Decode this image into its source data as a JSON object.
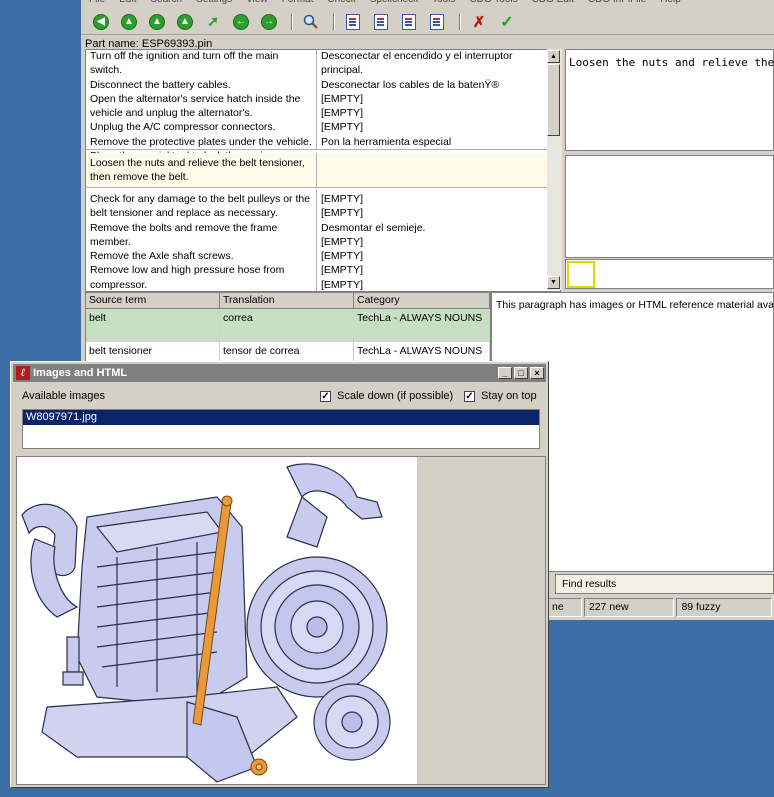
{
  "menu": [
    "File",
    "Edit",
    "Search",
    "Settings",
    "View",
    "Format",
    "Check",
    "Spellcheck",
    "Tools",
    "CDG Tools",
    "CDG Edit",
    "CDG InPlFile",
    "Help"
  ],
  "toolbar": {
    "icons": [
      "nav-first-icon",
      "nav-up-icon",
      "nav-up2-icon",
      "nav-up3-icon",
      "nav-arrow-icon",
      "nav-prev-icon",
      "nav-next-icon",
      "search-icon",
      "doc-icon-1",
      "doc-icon-2",
      "doc-icon-3",
      "doc-icon-4",
      "reject-icon",
      "accept-icon"
    ]
  },
  "part_name": "Part name: ESP69393.pin",
  "segments": [
    {
      "source": "Turn off the ignition and turn off the main switch.\nDisconnect the battery cables.\nOpen the alternator's service hatch inside the vehicle and unplug the alternator's.\nUnplug the A/C compressor connectors.\nRemove the protective plates under the vehicle.\nPlace the special tool to lock the engine.",
      "target": "Desconectar el encendido y el interruptor principal.\nDesconectar los cables de la batenŸ®\n[EMPTY]\n[EMPTY]\n[EMPTY]\nPon la herramienta especial"
    },
    {
      "source": "Loosen the nuts and relieve the belt tensioner, then remove the belt.",
      "target": ""
    },
    {
      "source": "Check for any damage to the belt pulleys or the belt tensioner and replace as necessary.\nRemove the bolts and remove the frame member.\nRemove the Axle shaft screws.\nRemove low and high pressure hose from compressor.",
      "target": "[EMPTY]\n[EMPTY]\nDesmontar el semieje.\n[EMPTY]\n[EMPTY]\n[EMPTY]\n[EMPTY]"
    }
  ],
  "source_pane_text": "Loosen the nuts and relieve the belt t",
  "terms": {
    "headers": [
      "Source term",
      "Translation",
      "Category"
    ],
    "rows": [
      {
        "source": "belt",
        "translation": "correa",
        "category": "TechLa - ALWAYS NOUNS"
      },
      {
        "source": "belt tensioner",
        "translation": "tensor de correa",
        "category": "TechLa - ALWAYS NOUNS"
      }
    ]
  },
  "info_text": "This paragraph has images or HTML reference material avai",
  "find_results_tab": "Find results",
  "status": {
    "left": "ne",
    "new_count": "227 new",
    "fuzzy_count": "89 fuzzy"
  },
  "images_window": {
    "title": "Images and HTML",
    "available_label": "Available images",
    "scale_down_label": "Scale down (if possible)",
    "scale_down_checked": true,
    "stay_on_top_label": "Stay on top",
    "stay_on_top_checked": true,
    "images": [
      "W8097971.jpg"
    ],
    "preview_icon": "engine-compressor-drawing"
  },
  "colors": {
    "desktop": "#3a6ea5",
    "selection": "#0a246a",
    "term_highlight": "#c7dfc3",
    "current_segment": "#fffbe8",
    "belt_highlight": "#e89a3a",
    "part_fill": "#c9cbee"
  }
}
